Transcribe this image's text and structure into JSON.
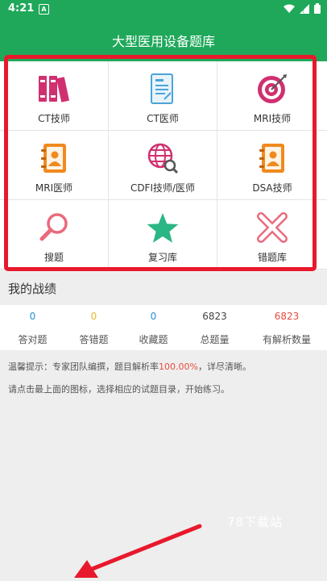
{
  "status_bar": {
    "time": "4:21",
    "a_icon": "A"
  },
  "app": {
    "title": "大型医用设备题库"
  },
  "grid": [
    {
      "label": "CT技师",
      "icon": "books-icon"
    },
    {
      "label": "CT医师",
      "icon": "document-icon"
    },
    {
      "label": "MRI技师",
      "icon": "target-icon"
    },
    {
      "label": "MRI医师",
      "icon": "contacts-icon"
    },
    {
      "label": "CDFI技师/医师",
      "icon": "globe-search-icon"
    },
    {
      "label": "DSA技师",
      "icon": "contacts-icon"
    },
    {
      "label": "搜题",
      "icon": "search-icon"
    },
    {
      "label": "复习库",
      "icon": "star-icon"
    },
    {
      "label": "错题库",
      "icon": "cross-icon"
    }
  ],
  "section_title": "我的战绩",
  "stats": [
    {
      "value": "0",
      "label": "答对题",
      "color": "#2a8fd6"
    },
    {
      "value": "0",
      "label": "答错题",
      "color": "#e8b832"
    },
    {
      "value": "0",
      "label": "收藏题",
      "color": "#2a8fd6"
    },
    {
      "value": "6823",
      "label": "总题量",
      "color": "#444444"
    },
    {
      "value": "6823",
      "label": "有解析数量",
      "color": "#e84c3d"
    }
  ],
  "tip": {
    "prefix": "温馨提示：专家团队编撰，题目解析率",
    "rate": "100.00%",
    "suffix": "，详尽清晰。",
    "line2": "请点击最上面的图标，选择相应的试题目录，开始练习。"
  },
  "watermark": "78下载站",
  "colors": {
    "brand": "#1fa85a",
    "highlight": "#e8192c",
    "rate": "#e84c3d"
  }
}
